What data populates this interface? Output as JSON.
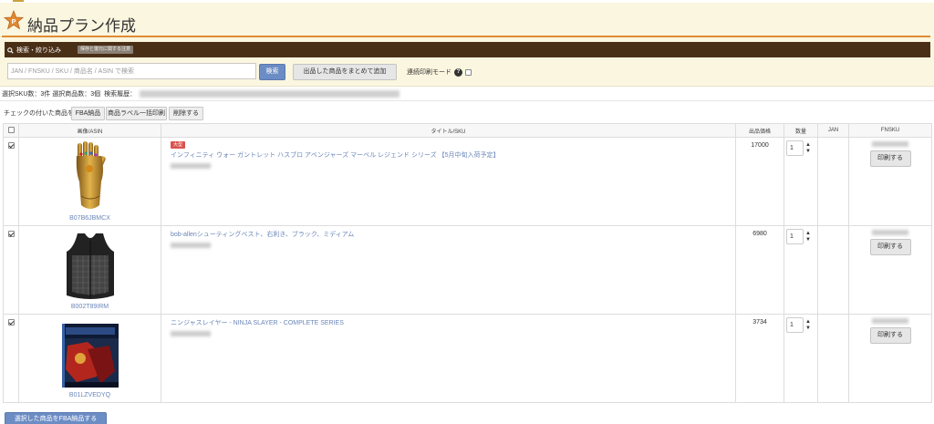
{
  "page": {
    "title": "納品プラン作成"
  },
  "search": {
    "section_label": "検索・絞り込み",
    "badge": "保存と復元に関する注意",
    "placeholder": "JAN / FNSKU / SKU / 商品名 / ASIN で検索",
    "search_button": "検索",
    "bulk_add_button": "出品した商品をまとめて追加",
    "continuous_print_label": "連続印刷モード"
  },
  "info": {
    "summary": "選択SKU数：3件 選択商品数：3個",
    "history_label": "検索履歴："
  },
  "bulk_actions": {
    "label": "チェックの付いた商品を",
    "fba_button": "FBA納品",
    "label_print_button": "商品ラベル一括印刷",
    "delete_button": "削除する"
  },
  "table": {
    "headers": {
      "image": "画像/ASIN",
      "title": "タイトル/SKU",
      "price": "出品価格",
      "qty": "数量",
      "jan": "JAN",
      "fnsku": "FNSKU"
    },
    "rows": [
      {
        "asin": "B07B6JBMCX",
        "tag": "大型",
        "title": "インフィニティ ウォー ガントレット ハスブロ アベンジャーズ マーベル レジェンド シリーズ 【5月中旬入荷予定】",
        "price": "17000",
        "qty": "1",
        "print_button": "印刷する",
        "checked": true
      },
      {
        "asin": "B002T89IRM",
        "tag": "",
        "title": "bob-allenシューティングベスト、右利き、ブラック、ミディアム",
        "price": "6980",
        "qty": "1",
        "print_button": "印刷する",
        "checked": true
      },
      {
        "asin": "B01LZVEDYQ",
        "tag": "",
        "title": "ニンジャスレイヤー - NINJA SLAYER - COMPLETE SERIES",
        "price": "3734",
        "qty": "1",
        "print_button": "印刷する",
        "checked": true
      }
    ]
  },
  "footer": {
    "submit_button": "選択した商品をFBA納品する"
  },
  "colors": {
    "accent_orange": "#e08a32",
    "bar_brown": "#4a2f17",
    "primary_blue": "#6c8cc4",
    "link_blue": "#6a86b8"
  }
}
